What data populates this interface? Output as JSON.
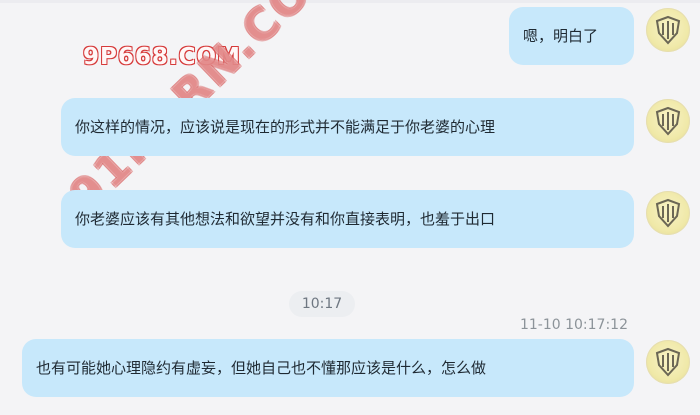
{
  "watermark": {
    "brand": "9P668.COM",
    "brand_diagonal": "91PORN.COM"
  },
  "messages": [
    {
      "text": "嗯，明白了"
    },
    {
      "text": "你这样的情况，应该说是现在的形式并不能满足于你老婆的心理"
    },
    {
      "text": "你老婆应该有其他想法和欲望并没有和你直接表明，也羞于出口"
    },
    {
      "text": "也有可能她心理隐约有虚妄，但她自己也不懂那应该是什么，怎么做"
    }
  ],
  "separator_time": "10:17",
  "last_timestamp": "11-10 10:17:12",
  "colors": {
    "bubble": "#c7e8fb",
    "background": "#f4f4f6",
    "avatar": "#f0e9a9",
    "watermark_red": "#d63a3a"
  },
  "icons": {
    "avatar": "stylized-gold-crest-icon"
  }
}
